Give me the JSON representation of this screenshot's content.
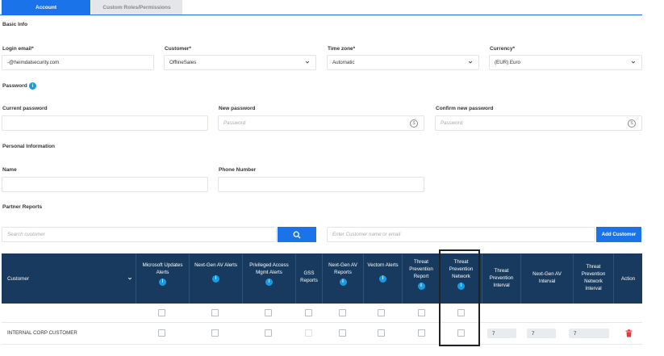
{
  "tabs": [
    {
      "label": "Account",
      "active": true
    },
    {
      "label": "Custom Roles/Permissions",
      "active": false
    }
  ],
  "basic_info": {
    "title": "Basic Info",
    "login_email": {
      "label": "Login email*",
      "value": "-@heimdalsecurity.com"
    },
    "customer": {
      "label": "Customer*",
      "value": "OfflineSales"
    },
    "time_zone": {
      "label": "Time zone*",
      "value": "Automatic"
    },
    "currency": {
      "label": "Currency*",
      "value": "(EUR) Euro"
    }
  },
  "password": {
    "title": "Password",
    "info_icon": "i",
    "current": {
      "label": "Current password"
    },
    "new": {
      "label": "New password",
      "placeholder": "Password"
    },
    "confirm": {
      "label": "Confirm new password",
      "placeholder": "Password"
    }
  },
  "personal": {
    "title": "Personal Information",
    "name": {
      "label": "Name"
    },
    "phone": {
      "label": "Phone Number"
    }
  },
  "partner_reports": {
    "title": "Partner Reports",
    "search_placeholder": "Search customer",
    "customer_placeholder": "Enter Customer name or email",
    "add_button": "Add Customer",
    "columns": [
      {
        "label": "Customer",
        "info": false
      },
      {
        "label": "Microsoft Updates Alerts",
        "info": true
      },
      {
        "label": "Next-Gen AV Alerts",
        "info": true
      },
      {
        "label": "Privileged Access Mgmt Alerts",
        "info": true
      },
      {
        "label": "GSS Reports",
        "info": false
      },
      {
        "label": "Next-Gen AV Reports",
        "info": true
      },
      {
        "label": "Vectorn Alerts",
        "info": true
      },
      {
        "label": "Threat Prevention Report",
        "info": true
      },
      {
        "label": "Threat Prevention Network",
        "info": true
      },
      {
        "label": "Threat Prevention Interval",
        "info": false
      },
      {
        "label": "Next-Gen AV Interval",
        "info": false
      },
      {
        "label": "Threat Prevention Network Interval",
        "info": false
      },
      {
        "label": "Action",
        "info": false
      }
    ],
    "rows": [
      {
        "customer": "",
        "intervals": []
      },
      {
        "customer": "INTERNAL CORP CUSTOMER",
        "intervals": [
          "7",
          "7",
          "7"
        ]
      }
    ]
  },
  "colors": {
    "accent": "#1a73e8",
    "header": "#173a5e",
    "info": "#1a9be0",
    "delete": "#e53935"
  }
}
